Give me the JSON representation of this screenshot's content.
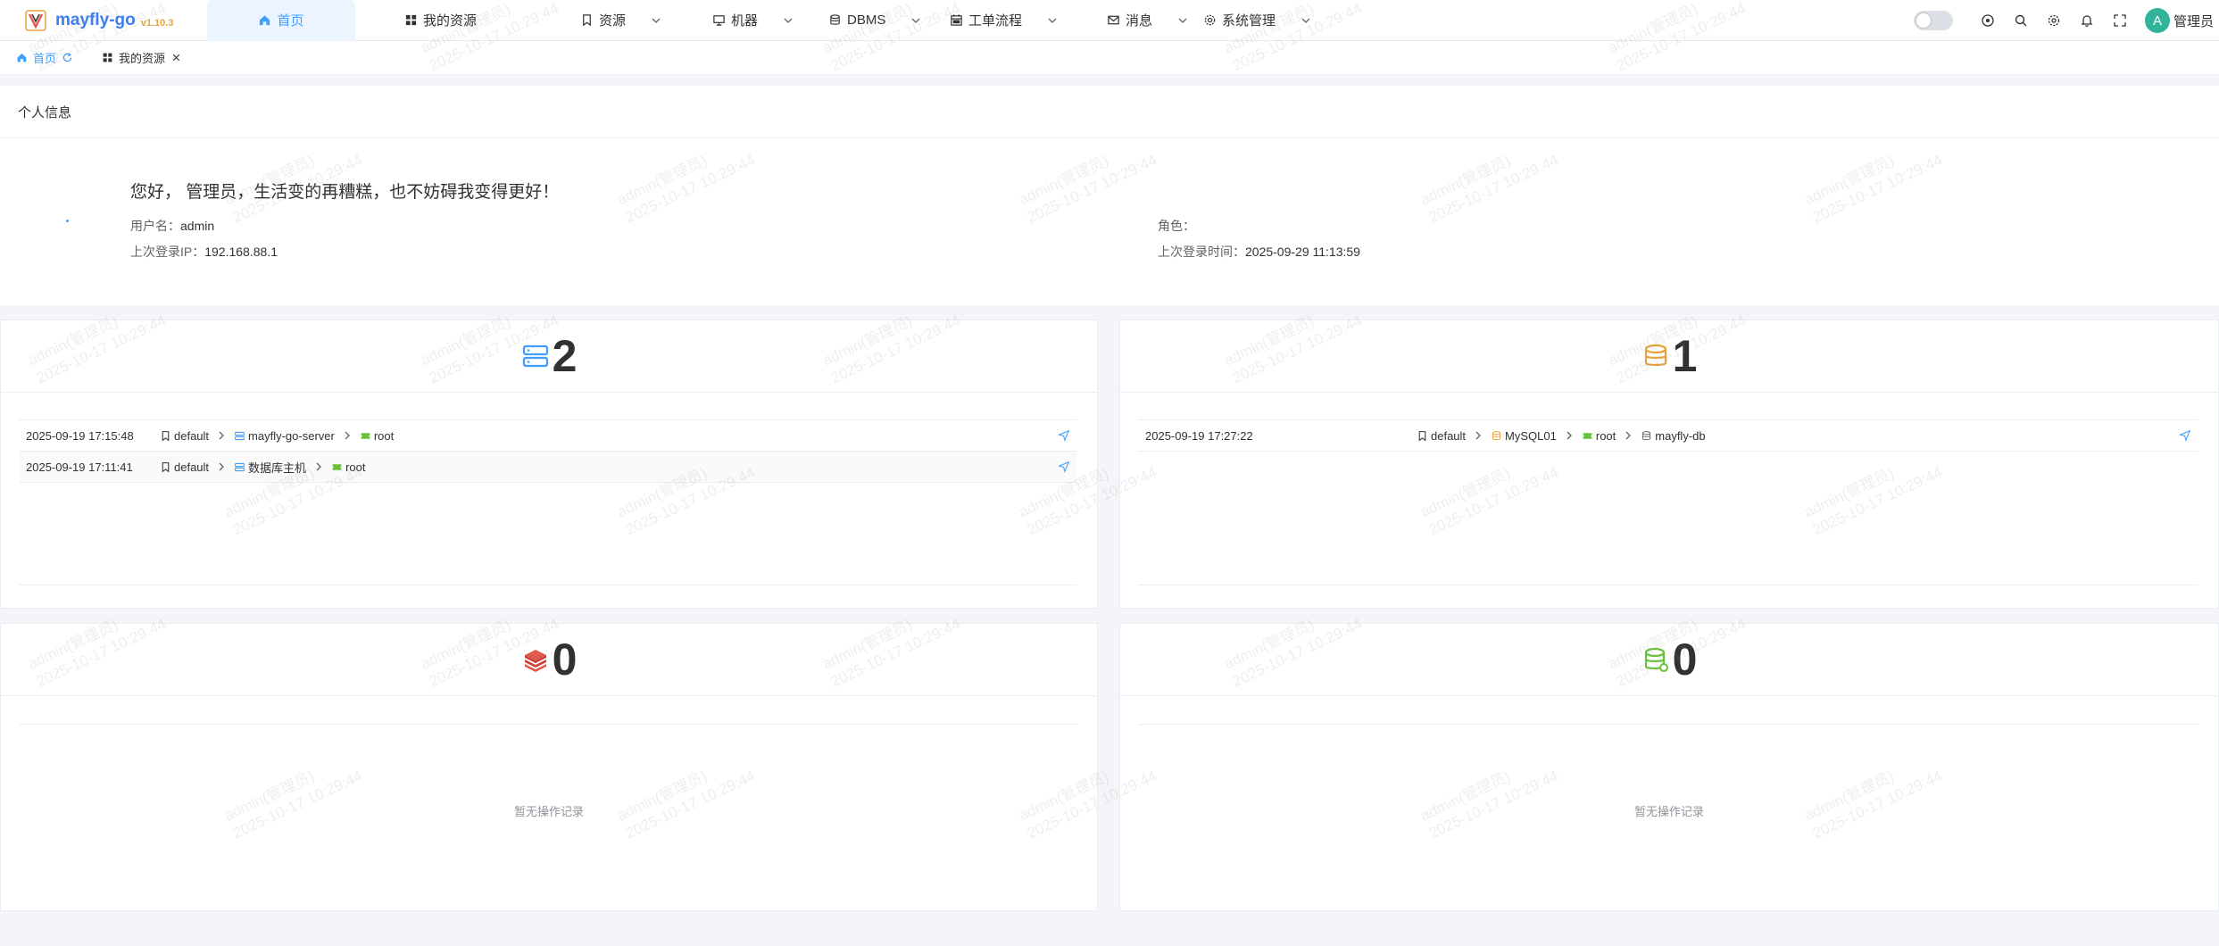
{
  "app": {
    "name": "mayfly-go",
    "version": "v1.10.3"
  },
  "nav": [
    {
      "label": "首页",
      "icon": "home-icon",
      "active": true,
      "dropdown": false
    },
    {
      "label": "我的资源",
      "icon": "grid-icon",
      "active": false,
      "dropdown": false
    },
    {
      "label": "资源",
      "icon": "bookmark-icon",
      "active": false,
      "dropdown": true
    },
    {
      "label": "机器",
      "icon": "monitor-icon",
      "active": false,
      "dropdown": true
    },
    {
      "label": "DBMS",
      "icon": "database-icon",
      "active": false,
      "dropdown": true
    },
    {
      "label": "工单流程",
      "icon": "calendar-icon",
      "active": false,
      "dropdown": true
    },
    {
      "label": "消息",
      "icon": "mail-icon",
      "active": false,
      "dropdown": true
    },
    {
      "label": "系统管理",
      "icon": "gear-icon",
      "active": false,
      "dropdown": true
    }
  ],
  "user": {
    "avatar_letter": "A",
    "name": "管理员"
  },
  "tags": [
    {
      "label": "首页",
      "active": true
    },
    {
      "label": "我的资源",
      "active": false
    }
  ],
  "profile": {
    "section_title": "个人信息",
    "greeting": "您好， 管理员，生活变的再糟糕，也不妨碍我变得更好！",
    "username_label": "用户名：",
    "username": "admin",
    "role_label": "角色：",
    "role": "",
    "last_ip_label": "上次登录IP：",
    "last_ip": "192.168.88.1",
    "last_time_label": "上次登录时间：",
    "last_time": "2025-09-29 11:13:59"
  },
  "cards": {
    "machine": {
      "count": "2",
      "records": [
        {
          "time": "2025-09-19 17:15:48",
          "tag": "default",
          "resource": "mayfly-go-server",
          "account": "root"
        },
        {
          "time": "2025-09-19 17:11:41",
          "tag": "default",
          "resource": "数据库主机",
          "account": "root"
        }
      ]
    },
    "db": {
      "count": "1",
      "records": [
        {
          "time": "2025-09-19 17:27:22",
          "tag": "default",
          "instance": "MySQL01",
          "account": "root",
          "database": "mayfly-db"
        }
      ]
    },
    "redis": {
      "count": "0",
      "empty": "暂无操作记录"
    },
    "mongo": {
      "count": "0",
      "empty": "暂无操作记录"
    }
  },
  "watermark": {
    "line1": "admin(管理员)",
    "line2": "2025-10-17 10:29:44"
  },
  "colors": {
    "accent": "#409eff",
    "brand": "#3d7ef0",
    "version": "#e6a23c",
    "avatar": "#31b39a",
    "db": "#e6a23c",
    "redis": "#e05b4b",
    "mongo": "#67c23a",
    "account": "#67c23a"
  }
}
